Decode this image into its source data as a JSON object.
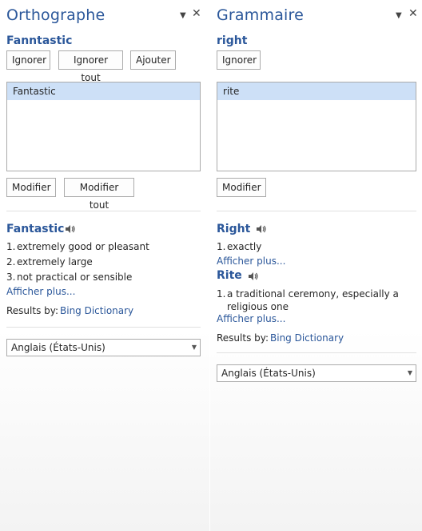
{
  "spelling_pane": {
    "title": "Orthographe",
    "word": "Fanntastic",
    "buttons": {
      "ignore": "Ignorer",
      "ignore_all": "Ignorer tout",
      "add": "Ajouter",
      "change": "Modifier",
      "change_all": "Modifier tout"
    },
    "suggestions": [
      "Fantastic"
    ],
    "definition": {
      "word": "Fantastic",
      "items": [
        {
          "num": "1.",
          "text": "extremely good or pleasant"
        },
        {
          "num": "2.",
          "text": "extremely large"
        },
        {
          "num": "3.",
          "text": "not practical or sensible"
        }
      ],
      "more": "Afficher plus..."
    },
    "results_by": "Results by:",
    "dictionary": "Bing Dictionary",
    "language": "Anglais (États-Unis)"
  },
  "grammar_pane": {
    "title": "Grammaire",
    "word": "right",
    "buttons": {
      "ignore": "Ignorer",
      "change": "Modifier"
    },
    "suggestions": [
      "rite"
    ],
    "definitions": [
      {
        "word": "Right",
        "items": [
          {
            "num": "1.",
            "text": "exactly"
          }
        ],
        "more": "Afficher plus..."
      },
      {
        "word": "Rite",
        "items": [
          {
            "num": "1.",
            "text": "a traditional ceremony, especially a religious one"
          }
        ],
        "more": "Afficher plus..."
      }
    ],
    "results_by": "Results by:",
    "dictionary": "Bing Dictionary",
    "language": "Anglais (États-Unis)"
  },
  "icons": {
    "menu": "chevron-down-icon",
    "close": "close-icon",
    "speaker": "speaker-icon"
  },
  "colors": {
    "accent": "#2b579a",
    "selection": "#cde0f7",
    "border": "#ababab"
  }
}
